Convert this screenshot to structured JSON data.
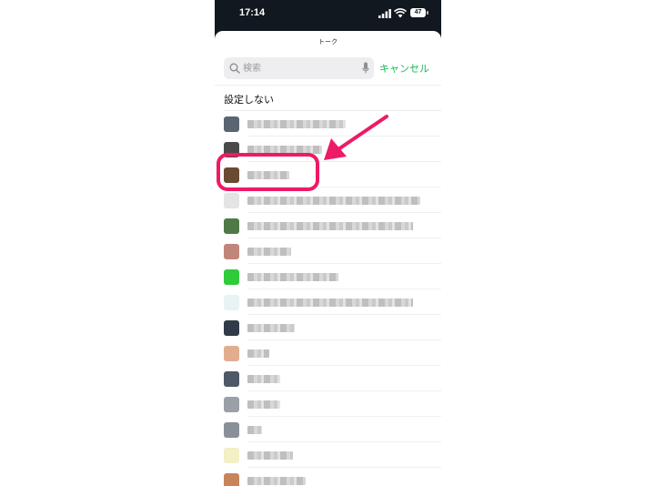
{
  "status_bar": {
    "time": "17:14",
    "battery": "47",
    "icons": [
      "signal-icon",
      "wifi-icon",
      "battery-icon"
    ]
  },
  "sheet": {
    "title": "トーク"
  },
  "search": {
    "placeholder": "検索",
    "value": "",
    "cancel_label": "キャンセル",
    "icons": [
      "search-icon",
      "mic-icon"
    ]
  },
  "list": {
    "no_setting_label": "設定しない",
    "contacts": [
      {
        "avatar_color": "#5a6472",
        "name_width": 108
      },
      {
        "avatar_color": "#4a4a4a",
        "name_width": 82
      },
      {
        "avatar_color": "#6b4a32",
        "name_width": 46,
        "highlighted": true
      },
      {
        "avatar_color": "#e4e4e4",
        "name_width": 190
      },
      {
        "avatar_color": "#4f7a46",
        "name_width": 182
      },
      {
        "avatar_color": "#c2857a",
        "name_width": 48
      },
      {
        "avatar_color": "#2ecc3a",
        "name_width": 100
      },
      {
        "avatar_color": "#e8f3f3",
        "name_width": 182
      },
      {
        "avatar_color": "#303a48",
        "name_width": 52
      },
      {
        "avatar_color": "#e2ad8e",
        "name_width": 24
      },
      {
        "avatar_color": "#4e5866",
        "name_width": 36
      },
      {
        "avatar_color": "#9aa0a6",
        "name_width": 36
      },
      {
        "avatar_color": "#8a9098",
        "name_width": 16
      },
      {
        "avatar_color": "#f2f0c4",
        "name_width": 50
      },
      {
        "avatar_color": "#c9845c",
        "name_width": 64
      }
    ]
  },
  "annotation": {
    "color": "#ee1a66"
  }
}
